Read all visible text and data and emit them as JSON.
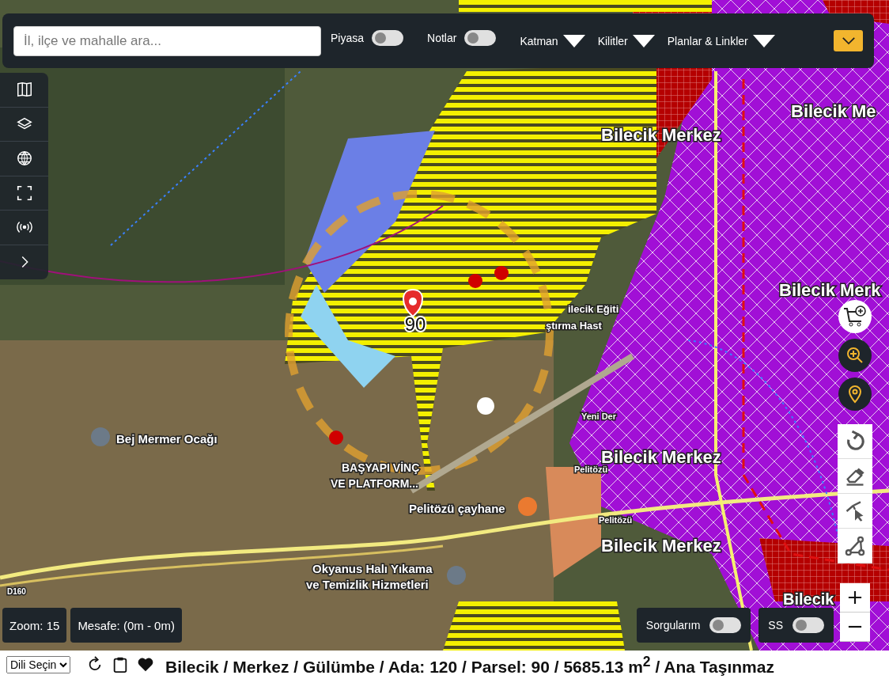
{
  "search": {
    "placeholder": "İl, ilçe ve mahalle ara..."
  },
  "toggles": [
    {
      "label": "Piyasa",
      "on": false
    },
    {
      "label": "Notlar",
      "on": false
    }
  ],
  "dropdowns": [
    {
      "label": "Katman"
    },
    {
      "label": "Kilitler"
    },
    {
      "label": "Planlar & Linkler"
    }
  ],
  "map": {
    "parcel_marker": "90",
    "labels": [
      "Bilecik Merkez",
      "Bilecik Me",
      "Bilecik Merk",
      "ilecik Eğiti",
      "ştırma Hast",
      "Bej Mermer Ocağı",
      "BAŞYAPI VİNÇ",
      "VE PLATFORM...",
      "Pelitözü çayhane",
      "Bilecik Merkez",
      "Pelitözü",
      "Pelitözü",
      "Bilecik Merkez",
      "Okyanus Halı Yıkama",
      "ve Temizlik Hizmetleri",
      "D160",
      "Yeni Der",
      "Bilecik"
    ]
  },
  "info": {
    "zoom": "Zoom: 15",
    "distance": "Mesafe: (0m - 0m)"
  },
  "bottom_toggles": [
    {
      "label": "Sorgularım",
      "on": false
    },
    {
      "label": "SS",
      "on": false
    }
  ],
  "status_bar": {
    "language": "Dili Seçin",
    "location": "Bilecik / Merkez / Gülümbe / Ada: 120 / Parsel: 90 / 5685.13 m$^{2}$ / Ana Taşınmaz"
  }
}
